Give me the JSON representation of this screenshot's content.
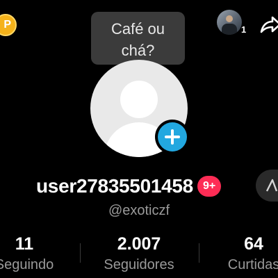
{
  "header": {
    "coin_badge_letter": "P",
    "friend_count": "1"
  },
  "tooltip": {
    "line1": "Café ou",
    "line2": "chá?"
  },
  "profile": {
    "username": "user27835501458",
    "notification_badge": "9+",
    "handle": "@exoticzf"
  },
  "stats": {
    "following": {
      "value": "11",
      "label": "Seguindo"
    },
    "followers": {
      "value": "2.007",
      "label": "Seguidores"
    },
    "likes": {
      "value": "64",
      "label": "Curtidas"
    }
  },
  "colors": {
    "background": "#000000",
    "accent_badge": "#fe2c55",
    "add_button": "#22a8e0",
    "coin": "#f5b21a"
  }
}
